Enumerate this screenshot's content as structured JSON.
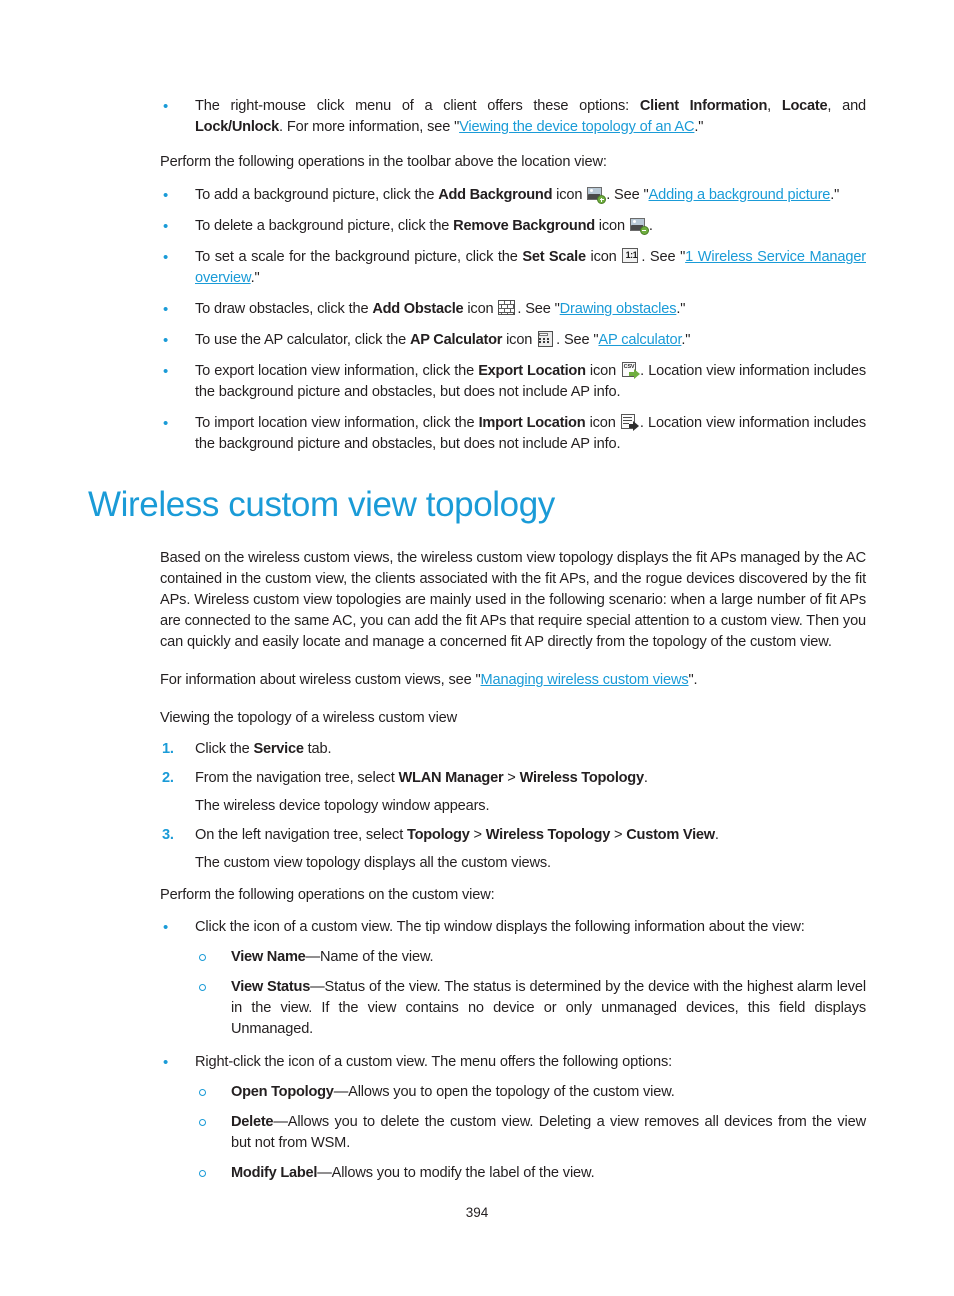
{
  "document": {
    "page_number": "394",
    "accent_color": "#1a9bd7",
    "text_color": "#231f20"
  },
  "top_bullets": {
    "item1": {
      "t1": "The right-mouse click menu of a client offers these options: ",
      "b1": "Client Information",
      "t2": ", ",
      "b2": "Locate",
      "t3": ", and ",
      "b3": "Lock/Unlock",
      "t4": ". For more information, see \"",
      "link": "Viewing the device topology of an AC",
      "t5": ".\""
    }
  },
  "toolbar_intro": "Perform the following operations in the toolbar above the location view:",
  "toolbar_bullets": [
    {
      "t1": "To add a background picture, click the ",
      "b1": "Add Background",
      "t2": " icon ",
      "icon": "add-background-icon",
      "t3": ". See \"",
      "link": "Adding a background picture",
      "t4": ".\""
    },
    {
      "t1": "To delete a background picture, click the ",
      "b1": "Remove Background",
      "t2": " icon ",
      "icon": "remove-background-icon",
      "t3": ".",
      "link": "",
      "t4": ""
    },
    {
      "t1": "To set a scale for the background picture, click the ",
      "b1": "Set Scale",
      "t2": " icon ",
      "icon": "set-scale-icon",
      "t3": ". See \"",
      "link": "1 Wireless Service Manager overview",
      "t4": ".\""
    },
    {
      "t1": "To draw obstacles, click the ",
      "b1": "Add Obstacle",
      "t2": " icon ",
      "icon": "add-obstacle-icon",
      "t3": ". See \"",
      "link": "Drawing obstacles",
      "t4": ".\""
    },
    {
      "t1": "To use the AP calculator, click the ",
      "b1": "AP Calculator",
      "t2": " icon ",
      "icon": "ap-calculator-icon",
      "t3": ". See \"",
      "link": "AP calculator",
      "t4": ".\""
    },
    {
      "t1": "To export location view information, click the ",
      "b1": "Export Location",
      "t2": " icon ",
      "icon": "export-location-icon",
      "t3": ". Location view information includes the background picture and obstacles, but does not include AP info.",
      "link": "",
      "t4": ""
    },
    {
      "t1": "To import location view information, click the ",
      "b1": "Import Location",
      "t2": " icon ",
      "icon": "import-location-icon",
      "t3": ". Location view information includes the background picture and obstacles, but does not include AP info.",
      "link": "",
      "t4": ""
    }
  ],
  "section": {
    "heading": "Wireless custom view topology",
    "intro_paragraph": "Based on the wireless custom views, the wireless custom view topology displays the fit APs managed by the AC contained in the custom view, the clients associated with the fit APs, and the rogue devices discovered by the fit APs. Wireless custom view topologies are mainly used in the following scenario: when a large number of fit APs are connected to the same AC, you can add the fit APs that require special attention to a custom view. Then you can quickly and easily locate and manage a concerned fit AP directly from the topology of the custom view.",
    "see_also": {
      "t1": "For information about wireless custom views, see \"",
      "link": "Managing wireless custom views",
      "t2": "\"."
    },
    "procedure_title": "Viewing the topology of a wireless custom view",
    "steps": [
      {
        "num": "1.",
        "t1": "Click the ",
        "b1": "Service",
        "t2": " tab.",
        "b2": "",
        "t3": "",
        "b3": "",
        "t4": "",
        "result": ""
      },
      {
        "num": "2.",
        "t1": "From the navigation tree, select ",
        "b1": "WLAN Manager",
        "t2": " > ",
        "b2": "Wireless Topology",
        "t3": ".",
        "b3": "",
        "t4": "",
        "result": "The wireless device topology window appears."
      },
      {
        "num": "3.",
        "t1": "On the left navigation tree, select ",
        "b1": "Topology",
        "t2": " > ",
        "b2": "Wireless Topology",
        "t3": " > ",
        "b3": "Custom View",
        "t4": ".",
        "result": "The custom view topology displays all the custom views."
      }
    ],
    "operations_intro": "Perform the following operations on the custom view:",
    "operation_bullets": [
      {
        "lead": "Click the icon of a custom view. The tip window displays the following information about the view:",
        "subitems": [
          {
            "b": "View Name",
            "t": "—Name of the view."
          },
          {
            "b": "View Status",
            "t": "—Status of the view. The status is determined by the device with the highest alarm level in the view. If the view contains no device or only unmanaged devices, this field displays Unmanaged."
          }
        ]
      },
      {
        "lead": "Right-click the icon of a custom view. The menu offers the following options:",
        "subitems": [
          {
            "b": "Open Topology",
            "t": "—Allows you to open the topology of the custom view."
          },
          {
            "b": "Delete",
            "t": "—Allows you to delete the custom view. Deleting a view removes all devices from the view but not from WSM."
          },
          {
            "b": "Modify Label",
            "t": "—Allows you to modify the label of the view."
          }
        ]
      }
    ]
  },
  "icons": {
    "set_scale_label": "1:1",
    "csv_label": "CSV"
  }
}
